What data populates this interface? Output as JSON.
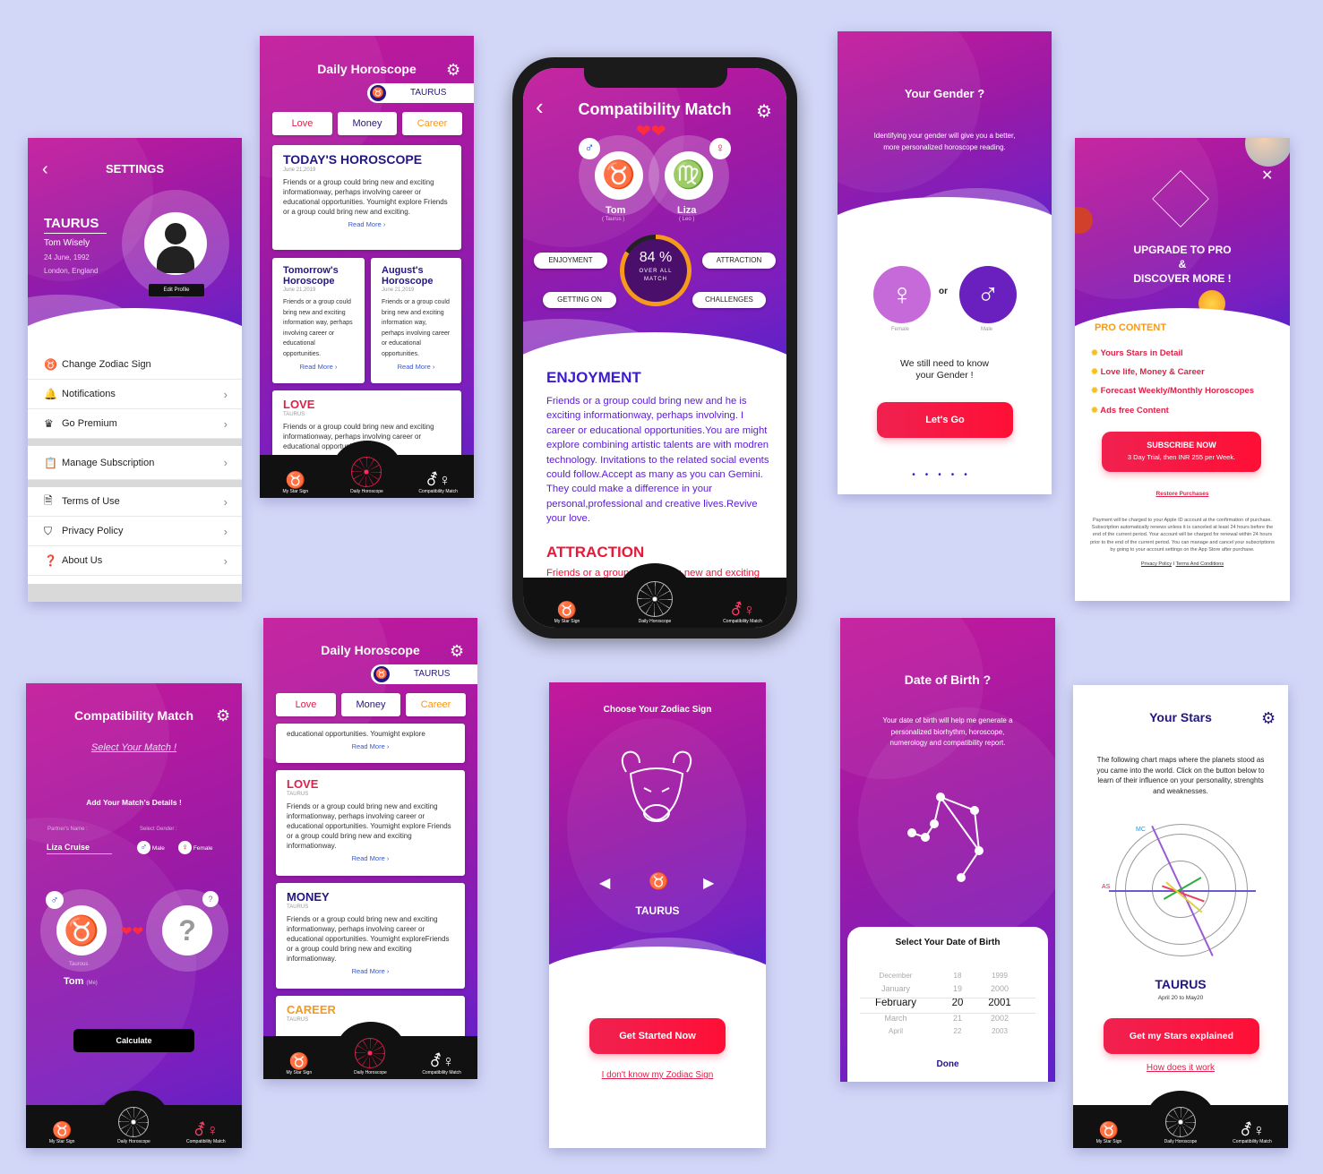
{
  "colors": {
    "background": "#d3d7f7",
    "brand_purple": "#9a1aa6",
    "deep_blue": "#231682",
    "accent_red": "#ff1f4b",
    "accent_orange": "#f59a1b",
    "love_red": "#e0204a"
  },
  "nav": {
    "items": [
      {
        "label": "My Star Sign",
        "icon": "taurus-icon"
      },
      {
        "label": "Daily Horoscope",
        "icon": "mandala-icon"
      },
      {
        "label": "Compatibility Match",
        "icon": "gender-pair-icon"
      }
    ]
  },
  "settings": {
    "title": "SETTINGS",
    "sign": "TAURUS",
    "name": "Tom Wisely",
    "dob": "24 June, 1992",
    "location": "London, England",
    "edit_profile": "Edit Profile",
    "menu": [
      {
        "label": "Change Zodiac Sign",
        "icon": "taurus-icon"
      },
      {
        "label": "Notifications",
        "icon": "bell-icon"
      },
      {
        "label": "Go Premium",
        "icon": "crown-icon"
      },
      {
        "label": "Manage Subscription",
        "icon": "clipboard-icon"
      },
      {
        "label": "Terms of Use",
        "icon": "document-icon"
      },
      {
        "label": "Privacy Policy",
        "icon": "shield-icon"
      },
      {
        "label": "About Us",
        "icon": "help-icon"
      }
    ]
  },
  "daily1": {
    "title": "Daily Horoscope",
    "sign": "TAURUS",
    "tabs": [
      "Love",
      "Money",
      "Career"
    ],
    "today": {
      "title": "TODAY'S HOROSCOPE",
      "date": "June 21,2019",
      "text": "Friends or a group could bring new and exciting informationway, perhaps involving career or educational opportunities. Youmight  explore Friends or a group could bring new and exciting.",
      "read_more": "Read More"
    },
    "tomorrow": {
      "title": "Tomorrow's Horoscope",
      "date": "June 21,2019",
      "text": "Friends or a group could bring new and exciting information way, perhaps involving career or educational opportunities.",
      "read_more": "Read More"
    },
    "august": {
      "title": "August's Horoscope",
      "date": "June 21,2019",
      "text": "Friends or a group could bring new and exciting information way, perhaps involving career or educational opportunities.",
      "read_more": "Read More"
    },
    "love": {
      "title": "LOVE",
      "sub": "TAURUS",
      "text": "Friends or a group could bring new and exciting informationway, perhaps involving career or educational opportunities."
    }
  },
  "compat": {
    "title": "Compatibility Match",
    "person1": {
      "name": "Tom",
      "sign": "( Taurus )"
    },
    "person2": {
      "name": "Liza",
      "sign": "( Leo )"
    },
    "percent": "84 %",
    "percent_value": 84,
    "match_label": "OVER ALL MATCH",
    "pills": [
      "ENJOYMENT",
      "ATTRACTION",
      "GETTING ON",
      "CHALLENGES"
    ],
    "section1": {
      "title": "ENJOYMENT",
      "text": "Friends or a group could bring new and he is exciting informationway, perhaps involving. I career or educational opportunities.You are might  explore combining artistic talents are with modren technology. Invitations to the related social events could follow.Accept as many as you can Gemini. They could make a difference in your personal,professional and creative lives.Revive your love."
    },
    "section2": {
      "title": "ATTRACTION",
      "text": "Friends or a group could bring new and exciting informationway, perhaps involvingcareer"
    }
  },
  "gender": {
    "title": "Your Gender ?",
    "desc": "Identifying your gender will give you a better, more personalized horoscope reading.",
    "female": "Female",
    "male": "Male",
    "or": "or",
    "prompt": "We still need to know your Gender !",
    "button": "Let's Go",
    "pages": 5
  },
  "pro": {
    "title1": "UPGRADE TO PRO",
    "amp": "&",
    "title2": "DISCOVER MORE !",
    "section": "PRO CONTENT",
    "features": [
      "Yours Stars in Detail",
      "Love life, Money & Career",
      "Forecast Weekly/Monthly Horoscopes",
      "Ads free Content"
    ],
    "subscribe": "SUBSCRIBE NOW",
    "trial": "3 Day Trial, then INR 255 per Week.",
    "restore": "Restore Purchases",
    "legal": "Payment will be charged to your Apple ID account at the confirmation of purchase. Subscription automatically renews unless it is canceled at least 24 hours before the end of the current period. Your account will be charged for renewal within 24 hours prior to the end of the current period. You can manage and cancel your subscriptions by going to your account settings on the App Store after purchase.",
    "privacy": "Privacy Policy",
    "sep": "I",
    "terms": "Terms And Conditions"
  },
  "select": {
    "title": "Compatibility Match",
    "subtitle": "Select Your Match !",
    "add": "Add Your Match's Details !",
    "partner_label": "Partner's Name :",
    "partner_value": "Liza Cruise",
    "gender_label": "Select Gender :",
    "male": "Male",
    "female": "Female",
    "me_sign": "Taurous",
    "me_name": "Tom",
    "me_tag": "(Me)",
    "unknown": "?",
    "calculate": "Calculate"
  },
  "daily2": {
    "title": "Daily Horoscope",
    "sign": "TAURUS",
    "tabs": [
      "Love",
      "Money",
      "Career"
    ],
    "top_text": "educational opportunities. Youmight  explore",
    "read_more": "Read More",
    "love": {
      "title": "LOVE",
      "sub": "TAURUS",
      "text": "Friends or a group could bring new and exciting informationway, perhaps involving career or educational opportunities. Youmight  explore Friends or a group could bring new and exciting informationway."
    },
    "money": {
      "title": "MONEY",
      "sub": "TAURUS",
      "text": "Friends or a group could bring new and exciting informationway, perhaps involving career or educational opportunities. Youmight  exploreFriends or a group could bring new and exciting informationway."
    },
    "career": {
      "title": "CAREER",
      "sub": "TAURUS"
    }
  },
  "zodiac": {
    "title": "Choose Your Zodiac Sign",
    "sign": "TAURUS",
    "button": "Get Started Now",
    "link": "I don't know my Zodiac Sign"
  },
  "dob": {
    "title": "Date of Birth ?",
    "desc": "Your date of birth will help me generate a personalized biorhythm, horoscope, numerology and compatibility report.",
    "picker_title": "Select Your Date of Birth",
    "months": [
      "December",
      "January",
      "February",
      "March",
      "April"
    ],
    "days": [
      "18",
      "19",
      "20",
      "21",
      "22"
    ],
    "years": [
      "1999",
      "2000",
      "2001",
      "2002",
      "2003"
    ],
    "done": "Done"
  },
  "stars": {
    "title": "Your Stars",
    "desc": "The following chart maps where the planets stood as you came into the world. Click on the button below to learn of their influence on your personality, strenghts and weaknesses.",
    "sign": "TAURUS",
    "range": "April 20 to May20",
    "button": "Get my Stars explained",
    "link": "How does it work"
  }
}
